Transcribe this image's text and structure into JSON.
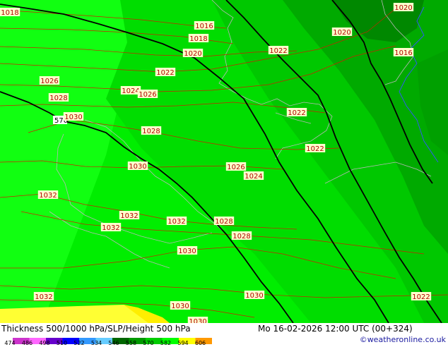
{
  "map": {
    "title": "Thickness 500/1000 hPa/SLP/Height 500 hPa",
    "valid_time": "Mo 16-02-2026 12:00 UTC (00+324)",
    "credit": "©weatheronline.co.uk",
    "height_500_label": "570",
    "slp_labels": [
      "1018",
      "1016",
      "1018",
      "1020",
      "1020",
      "1020",
      "1016",
      "1022",
      "1022",
      "1026",
      "1024",
      "1026",
      "1028",
      "1030",
      "1022",
      "1028",
      "1022",
      "1030",
      "1026",
      "1024",
      "1032",
      "1032",
      "1032",
      "1032",
      "1028",
      "1028",
      "1030",
      "1030",
      "1022",
      "1032",
      "1030",
      "1030"
    ],
    "legend": {
      "ticks": [
        "474",
        "486",
        "498",
        "510",
        "522",
        "534",
        "546",
        "558",
        "570",
        "582",
        "594",
        "606"
      ],
      "colors": [
        "#cc33cc",
        "#ff66ff",
        "#6600cc",
        "#0000ff",
        "#3399ff",
        "#66ccff",
        "#006600",
        "#009900",
        "#00cc00",
        "#00ff00",
        "#ffff00",
        "#ff9900"
      ]
    },
    "colors": {
      "thickness_546": "#00bb00",
      "thickness_552": "#00dd00",
      "thickness_558": "#00ff00",
      "thickness_534": "#008800",
      "thickness_528": "#006600",
      "height_contour": "#000000",
      "isobar": "#cc2200",
      "coast": "#c0c0c0"
    }
  }
}
